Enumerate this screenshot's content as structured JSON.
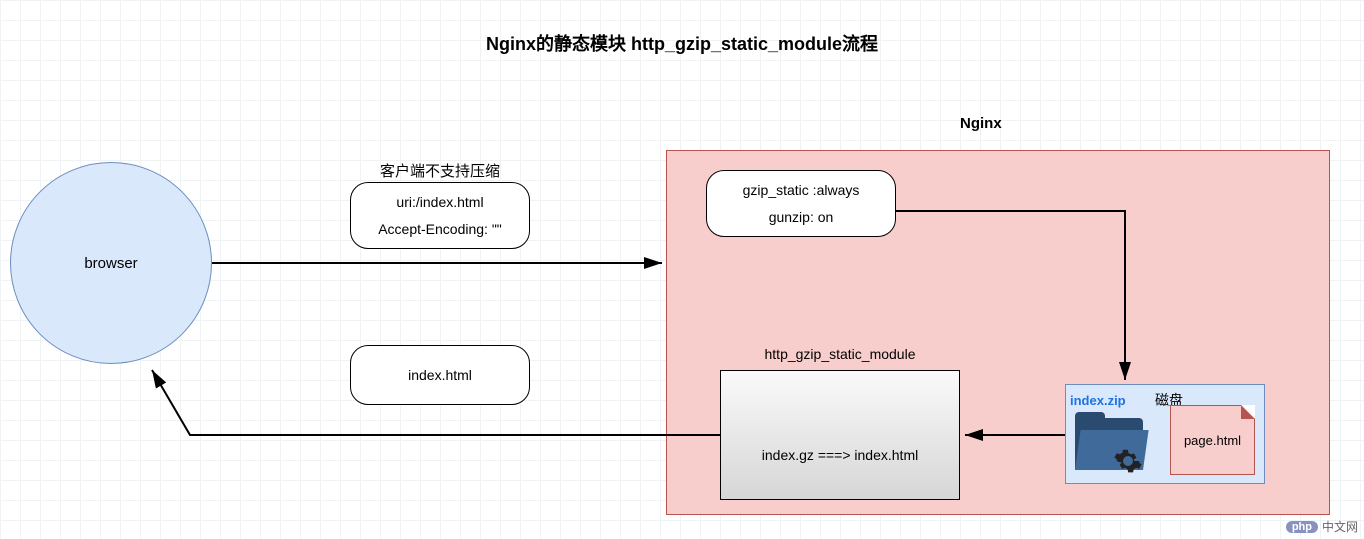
{
  "title": "Nginx的静态模块 http_gzip_static_module流程",
  "nginx_label": "Nginx",
  "browser": {
    "label": "browser"
  },
  "client_note": "客户端不支持压缩",
  "request": {
    "line1": "uri:/index.html",
    "line2": "Accept-Encoding: \"\""
  },
  "config": {
    "line1": "gzip_static :always",
    "line2": "gunzip: on"
  },
  "response": {
    "line1": "index.html"
  },
  "module": {
    "label": "http_gzip_static_module",
    "body": "index.gz ===> index.html"
  },
  "disk": {
    "label": "磁盘",
    "zip": "index.zip",
    "page": "page.html"
  },
  "watermark": {
    "php": "php",
    "text": "中文网"
  }
}
